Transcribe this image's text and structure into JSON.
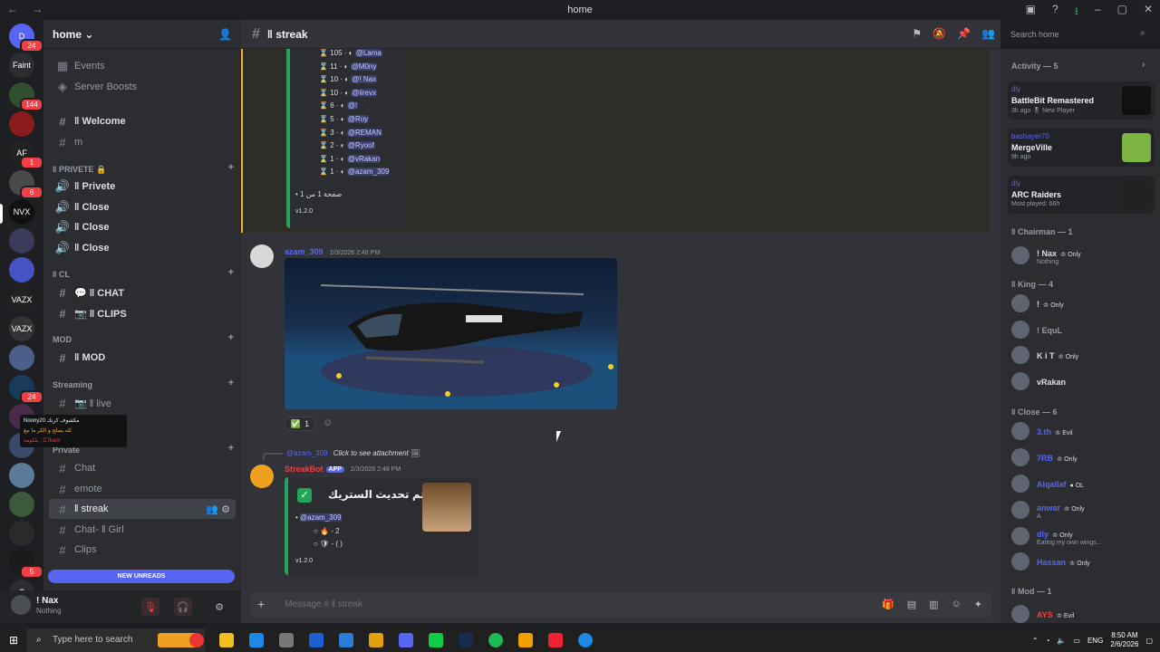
{
  "window": {
    "title": "home",
    "nav": "← →"
  },
  "guilds": [
    {
      "label": "D",
      "badge": "24",
      "color": "#5865f2"
    },
    {
      "label": "Faint",
      "badge": "",
      "color": "#2b2d31"
    },
    {
      "label": "",
      "badge": "144",
      "color": "#2f4f2f"
    },
    {
      "label": "",
      "badge": "",
      "color": "#8b1c1c"
    },
    {
      "label": "AF",
      "badge": "1",
      "color": "#222"
    },
    {
      "label": "",
      "badge": "6",
      "color": "#4a4a4a"
    },
    {
      "label": "NVX",
      "badge": "",
      "color": "#111"
    },
    {
      "label": "",
      "badge": "",
      "color": "#3b3b5a"
    },
    {
      "label": "",
      "badge": "",
      "color": "#4752c4"
    },
    {
      "label": "VAZX",
      "badge": "",
      "color": "#222"
    },
    {
      "label": "VAZX",
      "badge": "",
      "color": "#333"
    },
    {
      "label": "",
      "badge": "",
      "color": "#4b5f8a"
    },
    {
      "label": "",
      "badge": "24",
      "color": "#1a3a5a"
    },
    {
      "label": "",
      "badge": "",
      "color": "#4a2a4a"
    },
    {
      "label": "",
      "badge": "",
      "color": "#3a4a6a"
    },
    {
      "label": "",
      "badge": "",
      "color": "#5a7a9a"
    },
    {
      "label": "",
      "badge": "",
      "color": "#3a5a3a"
    },
    {
      "label": "",
      "badge": "",
      "color": "#2a2a2a"
    },
    {
      "label": "",
      "badge": "5",
      "color": "#1a1a1a"
    },
    {
      "label": "C",
      "badge": "",
      "color": "#2b2d31"
    }
  ],
  "server": {
    "name": "home",
    "top_items": [
      {
        "icon": "▦",
        "label": "Events"
      },
      {
        "icon": "◈",
        "label": "Server Boosts"
      }
    ]
  },
  "channels": [
    {
      "type": "ch",
      "icon": "#",
      "label": "‖ Welcome",
      "bright": true
    },
    {
      "type": "ch",
      "icon": "#",
      "label": "m",
      "bright": false
    },
    {
      "type": "cat",
      "label": "‖ PRIVETE 🔒"
    },
    {
      "type": "ch",
      "icon": "🔊",
      "label": "‖ Privete",
      "bright": true
    },
    {
      "type": "ch",
      "icon": "🔊",
      "label": "‖ Close",
      "bright": true
    },
    {
      "type": "ch",
      "icon": "🔊",
      "label": "‖ Close",
      "bright": true
    },
    {
      "type": "ch",
      "icon": "🔊",
      "label": "‖ Close",
      "bright": true
    },
    {
      "type": "cat",
      "label": "‖ CL"
    },
    {
      "type": "ch",
      "icon": "#",
      "label": "💬 ‖ CHAT",
      "bright": true
    },
    {
      "type": "ch",
      "icon": "#",
      "label": "📷 ‖ CLIPS",
      "bright": true
    },
    {
      "type": "cat",
      "label": "MOD"
    },
    {
      "type": "ch",
      "icon": "#",
      "label": "‖ MOD",
      "bright": true
    },
    {
      "type": "cat",
      "label": "Streaming"
    },
    {
      "type": "ch",
      "icon": "#",
      "label": "📷 ‖ live",
      "bright": false
    },
    {
      "type": "ch",
      "icon": "🔊",
      "label": "‖ live",
      "bright": false
    },
    {
      "type": "cat",
      "label": "Private"
    },
    {
      "type": "ch",
      "icon": "#",
      "label": "Chat",
      "bright": false
    },
    {
      "type": "ch",
      "icon": "#",
      "label": "emote",
      "bright": false
    },
    {
      "type": "ch",
      "icon": "#",
      "label": "‖ streak",
      "bright": false,
      "selected": true
    },
    {
      "type": "ch",
      "icon": "#",
      "label": "Chat- ‖ Girl",
      "bright": false
    },
    {
      "type": "ch",
      "icon": "#",
      "label": "Clips",
      "bright": false
    }
  ],
  "new_unreads": "NEW UNREADS",
  "voice_popup": [
    "Noony20 مكشوف كرنك",
    "لله يصلح و الكر ما نبغ",
    "يلكومه : C7kam"
  ],
  "user": {
    "name": "! Nax",
    "status": "Nothing"
  },
  "header": {
    "channel": "‖ streak",
    "search_placeholder": "Search home"
  },
  "leaderboard": [
    {
      "rank": "105",
      "user": "@Lama"
    },
    {
      "rank": "11",
      "user": "@M0ny"
    },
    {
      "rank": "10",
      "user": "@!    Nax"
    },
    {
      "rank": "10",
      "user": "@iirevx"
    },
    {
      "rank": "6",
      "user": "@!"
    },
    {
      "rank": "5",
      "user": "@Roy"
    },
    {
      "rank": "3",
      "user": "@REMAN"
    },
    {
      "rank": "2",
      "user": "@Ryoof"
    },
    {
      "rank": "1",
      "user": "@vRakan"
    },
    {
      "rank": "1",
      "user": "@azam_309"
    }
  ],
  "leaderboard_page": "صفحة 1 من 1",
  "leaderboard_version": "v1.2.0",
  "msg1": {
    "author": "azam_309",
    "time": "2/3/2026 2:48 PM",
    "reaction_count": "1"
  },
  "msg2": {
    "reply_user": "@azam_309",
    "reply_text": "Click to see attachment",
    "author": "StreakBot",
    "app_tag": "APP",
    "time": "2/3/2026 2:48 PM",
    "embed_title": "تم تحديث الستريك •",
    "mention": "@azam_309",
    "streak": "2",
    "history": "(     )",
    "version": "v1.2.0"
  },
  "input_placeholder": "Message # ‖ streak",
  "activity": {
    "header": "Activity — 5",
    "cards": [
      {
        "user": "dly",
        "title": "BattleBit Remastered",
        "meta": "3h ago  🎖 New Player",
        "thumb": "#111"
      },
      {
        "user": "bashayer70",
        "title": "MergeVille",
        "meta": "9h ago",
        "thumb": "#7cb342"
      },
      {
        "user": "dly",
        "title": "ARC Raiders",
        "meta": "Most played: 66h",
        "thumb": "#222"
      }
    ]
  },
  "member_groups": [
    {
      "title": "‖ Chairman — 1",
      "members": [
        {
          "name": "! Nax",
          "tag": "♔ Only",
          "sub": "Nothing",
          "color": "#dbdee1"
        }
      ]
    },
    {
      "title": "‖ King — 4",
      "members": [
        {
          "name": "!",
          "tag": "♔ Only",
          "sub": "",
          "color": "#dbdee1"
        },
        {
          "name": "! EquL",
          "tag": "",
          "sub": "",
          "color": "#949ba4"
        },
        {
          "name": "K i T",
          "tag": "♔ Only",
          "sub": "",
          "color": "#dbdee1"
        },
        {
          "name": "vRakan",
          "tag": "",
          "sub": "",
          "color": "#dbdee1"
        }
      ]
    },
    {
      "title": "‖ Close — 6",
      "members": [
        {
          "name": "3.th",
          "tag": "♔ Evil",
          "sub": "",
          "color": "#5865f2"
        },
        {
          "name": "7RB",
          "tag": "♔ Only",
          "sub": "",
          "color": "#5865f2"
        },
        {
          "name": "Alqallaf",
          "tag": "● OL",
          "sub": "",
          "color": "#5865f2"
        },
        {
          "name": "anwar",
          "tag": "♔ Only",
          "sub": "A",
          "color": "#5865f2"
        },
        {
          "name": "dly",
          "tag": "♔ Only",
          "sub": "Eating my own wings...",
          "color": "#5865f2"
        },
        {
          "name": "Hassan",
          "tag": "♔ Only",
          "sub": "",
          "color": "#5865f2"
        }
      ]
    },
    {
      "title": "‖ Mod — 1",
      "members": [
        {
          "name": "AYS",
          "tag": "♔ Evil",
          "sub": "",
          "color": "#f23f43"
        }
      ]
    }
  ],
  "taskbar": {
    "search": "Type here to search",
    "lang": "ENG",
    "time": "8:50 AM",
    "date": "2/6/2026"
  }
}
